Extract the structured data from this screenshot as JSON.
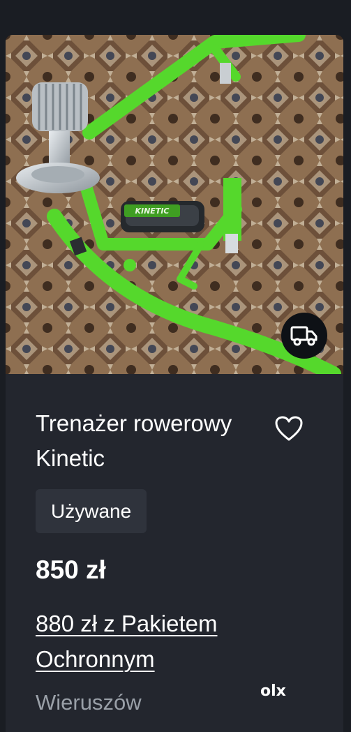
{
  "listing": {
    "title": "Trenażer rowerowy Kinetic",
    "condition": "Używane",
    "price": "850 zł",
    "protection_offer": "880 zł z Pakietem Ochronnym",
    "location": "Wieruszów",
    "brand_watermark": "olx",
    "photo_brand_text": "KINETIC"
  },
  "icons": {
    "delivery": "truck-icon",
    "favorite": "heart-outline-icon"
  },
  "colors": {
    "page_background": "#1a1d23",
    "card_background": "#23262e",
    "badge_background": "#2f333c",
    "secondary_text": "#9aa0a8",
    "frame_green": "#55d82c"
  }
}
